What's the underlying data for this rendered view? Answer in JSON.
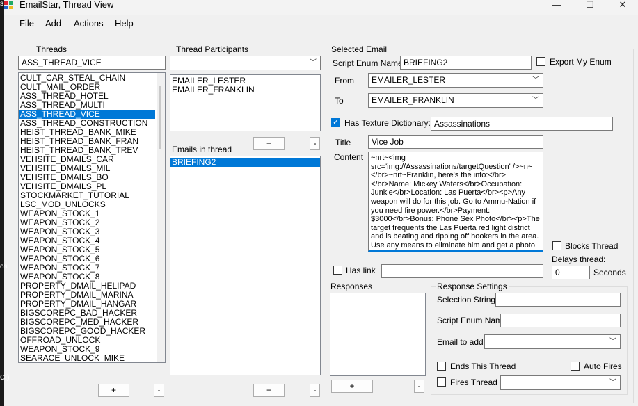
{
  "window": {
    "title": "EmailStar, Thread View",
    "min": "—",
    "max": "☐",
    "close": "✕"
  },
  "menu": [
    "File",
    "Add",
    "Actions",
    "Help"
  ],
  "threads": {
    "label": "Threads",
    "selected_value": "ASS_THREAD_VICE",
    "items": [
      "CULT_CAR_STEAL_CHAIN",
      "CULT_MAIL_ORDER",
      "ASS_THREAD_HOTEL",
      "ASS_THREAD_MULTI",
      "ASS_THREAD_VICE",
      "ASS_THREAD_CONSTRUCTION",
      "HEIST_THREAD_BANK_MIKE",
      "HEIST_THREAD_BANK_FRAN",
      "HEIST_THREAD_BANK_TREV",
      "VEHSITE_DMAILS_CAR",
      "VEHSITE_DMAILS_MIL",
      "VEHSITE_DMAILS_BO",
      "VEHSITE_DMAILS_PL",
      "STOCKMARKET_TUTORIAL",
      "LSC_MOD_UNLOCKS",
      "WEAPON_STOCK_1",
      "WEAPON_STOCK_2",
      "WEAPON_STOCK_3",
      "WEAPON_STOCK_4",
      "WEAPON_STOCK_5",
      "WEAPON_STOCK_6",
      "WEAPON_STOCK_7",
      "WEAPON_STOCK_8",
      "PROPERTY_DMAIL_HELIPAD",
      "PROPERTY_DMAIL_MARINA",
      "PROPERTY_DMAIL_HANGAR",
      "BIGSCOREPC_BAD_HACKER",
      "BIGSCOREPC_MED_HACKER",
      "BIGSCOREPC_GOOD_HACKER",
      "OFFROAD_UNLOCK",
      "WEAPON_STOCK_9",
      "SEARACE_UNLOCK_MIKE"
    ],
    "selected_index": 4,
    "add": "+",
    "remove": "-"
  },
  "participants": {
    "label": "Thread Participants",
    "items": [
      "EMAILER_LESTER",
      "EMAILER_FRANKLIN"
    ],
    "add": "+",
    "remove": "-"
  },
  "emails": {
    "label": "Emails in thread",
    "items": [
      "BRIEFING2"
    ],
    "add": "+",
    "remove": "-"
  },
  "selected_email": {
    "group_label": "Selected Email",
    "script_enum_label": "Script Enum Name",
    "script_enum_value": "BRIEFING2",
    "export_label": "Export My Enum",
    "from_label": "From",
    "from_value": "EMAILER_LESTER",
    "to_label": "To",
    "to_value": "EMAILER_FRANKLIN",
    "has_texture_label": "Has Texture Dictionary:",
    "texture_value": "Assassinations",
    "title_label": "Title",
    "title_value": "Vice Job",
    "content_label": "Content",
    "content_value": "~nrt~<img src='img://Assassinations/targetQuestion' />~n~</br>~nrt~Franklin, here's the info:</br></br>Name: Mickey Waters</br>Occupation: Junkie</br>Location: Las Puerta</br><p>Any weapon will do for this job. Go to Ammu-Nation if you need fire power.</br>Payment: $3000</br>Bonus: Phone Sex Photo</br><p>The target frequents the Las Puerta red light district and is beating and ripping off hookers in the area. Use any means to eliminate him and get a photo of him with",
    "blocks_thread_label": "Blocks Thread",
    "delays_label": "Delays thread:",
    "delays_value": "0",
    "seconds_label": "Seconds",
    "has_link_label": "Has link",
    "link_value": ""
  },
  "responses": {
    "label": "Responses",
    "add": "+",
    "remove": "-"
  },
  "response_settings": {
    "label": "Response Settings",
    "selection_string_label": "Selection String",
    "script_enum_label": "Script Enum Name",
    "email_to_add_label": "Email to add",
    "ends_thread_label": "Ends This Thread",
    "auto_fires_label": "Auto Fires",
    "fires_thread_label": "Fires Thread"
  },
  "edge_left": {
    "top": "s",
    "middle": "os",
    "bottom": "C:)"
  }
}
